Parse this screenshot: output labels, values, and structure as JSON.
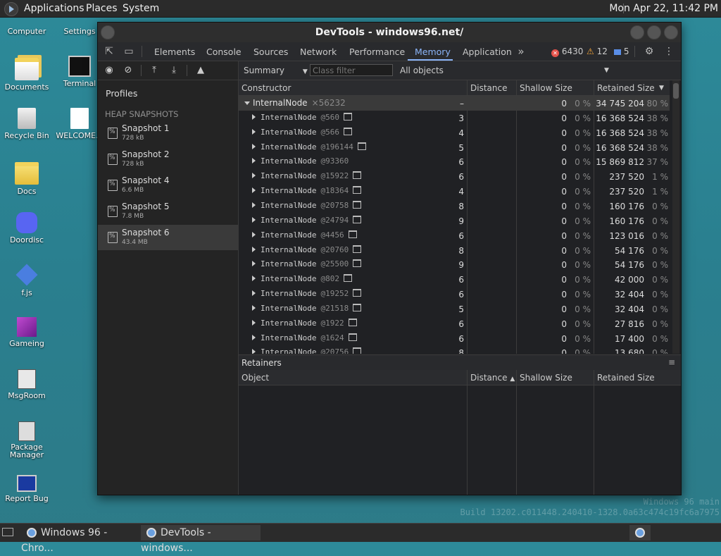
{
  "top_panel": {
    "menu": [
      "Applications",
      "Places",
      "System"
    ],
    "clock": "Mon Apr 22, 11:42 PM"
  },
  "desktop": {
    "icons": [
      "Computer",
      "Settings",
      "Documents",
      "Terminal",
      "Recycle Bin",
      "WELCOME...",
      "Docs",
      "Doordisc",
      "f.js",
      "Gameing",
      "MsgRoom",
      "Package Manager",
      "Report Bug"
    ]
  },
  "window": {
    "title": "DevTools - windows96.net/"
  },
  "devtools": {
    "tabs": [
      "Elements",
      "Console",
      "Sources",
      "Network",
      "Performance",
      "Memory",
      "Application"
    ],
    "active_tab": "Memory",
    "errors": "6430",
    "warnings": "12",
    "messages": "5",
    "left": {
      "profiles_title": "Profiles",
      "heap_header": "HEAP SNAPSHOTS",
      "snapshots": [
        {
          "name": "Snapshot 1",
          "size": "728 kB"
        },
        {
          "name": "Snapshot 2",
          "size": "728 kB"
        },
        {
          "name": "Snapshot 4",
          "size": "6.6 MB"
        },
        {
          "name": "Snapshot 5",
          "size": "7.8 MB"
        },
        {
          "name": "Snapshot 6",
          "size": "43.4 MB"
        }
      ]
    },
    "filter": {
      "view": "Summary",
      "class_filter_placeholder": "Class filter",
      "objects": "All objects"
    },
    "columns": {
      "constructor": "Constructor",
      "distance": "Distance",
      "shallow": "Shallow Size",
      "retained": "Retained Size"
    },
    "parent_row": {
      "name": "InternalNode",
      "id": "×56232",
      "distance": "–",
      "shallow": "0",
      "shallow_pct": "0 %",
      "retained": "34 745 204",
      "retained_pct": "80 %"
    },
    "rows": [
      {
        "name": "InternalNode",
        "id": "@560",
        "icon": true,
        "distance": "3",
        "shallow": "0",
        "shallow_pct": "0 %",
        "retained": "16 368 524",
        "retained_pct": "38 %"
      },
      {
        "name": "InternalNode",
        "id": "@566",
        "icon": true,
        "distance": "4",
        "shallow": "0",
        "shallow_pct": "0 %",
        "retained": "16 368 524",
        "retained_pct": "38 %"
      },
      {
        "name": "InternalNode",
        "id": "@196144",
        "icon": true,
        "distance": "5",
        "shallow": "0",
        "shallow_pct": "0 %",
        "retained": "16 368 524",
        "retained_pct": "38 %"
      },
      {
        "name": "InternalNode",
        "id": "@93360",
        "icon": false,
        "distance": "6",
        "shallow": "0",
        "shallow_pct": "0 %",
        "retained": "15 869 812",
        "retained_pct": "37 %"
      },
      {
        "name": "InternalNode",
        "id": "@15922",
        "icon": true,
        "distance": "6",
        "shallow": "0",
        "shallow_pct": "0 %",
        "retained": "237 520",
        "retained_pct": "1 %"
      },
      {
        "name": "InternalNode",
        "id": "@18364",
        "icon": true,
        "distance": "4",
        "shallow": "0",
        "shallow_pct": "0 %",
        "retained": "237 520",
        "retained_pct": "1 %"
      },
      {
        "name": "InternalNode",
        "id": "@20758",
        "icon": true,
        "distance": "8",
        "shallow": "0",
        "shallow_pct": "0 %",
        "retained": "160 176",
        "retained_pct": "0 %"
      },
      {
        "name": "InternalNode",
        "id": "@24794",
        "icon": true,
        "distance": "9",
        "shallow": "0",
        "shallow_pct": "0 %",
        "retained": "160 176",
        "retained_pct": "0 %"
      },
      {
        "name": "InternalNode",
        "id": "@4456",
        "icon": true,
        "distance": "6",
        "shallow": "0",
        "shallow_pct": "0 %",
        "retained": "123 016",
        "retained_pct": "0 %"
      },
      {
        "name": "InternalNode",
        "id": "@20760",
        "icon": true,
        "distance": "8",
        "shallow": "0",
        "shallow_pct": "0 %",
        "retained": "54 176",
        "retained_pct": "0 %"
      },
      {
        "name": "InternalNode",
        "id": "@25500",
        "icon": true,
        "distance": "9",
        "shallow": "0",
        "shallow_pct": "0 %",
        "retained": "54 176",
        "retained_pct": "0 %"
      },
      {
        "name": "InternalNode",
        "id": "@802",
        "icon": true,
        "distance": "6",
        "shallow": "0",
        "shallow_pct": "0 %",
        "retained": "42 000",
        "retained_pct": "0 %"
      },
      {
        "name": "InternalNode",
        "id": "@19252",
        "icon": true,
        "distance": "6",
        "shallow": "0",
        "shallow_pct": "0 %",
        "retained": "32 404",
        "retained_pct": "0 %"
      },
      {
        "name": "InternalNode",
        "id": "@21518",
        "icon": true,
        "distance": "5",
        "shallow": "0",
        "shallow_pct": "0 %",
        "retained": "32 404",
        "retained_pct": "0 %"
      },
      {
        "name": "InternalNode",
        "id": "@1922",
        "icon": true,
        "distance": "6",
        "shallow": "0",
        "shallow_pct": "0 %",
        "retained": "27 816",
        "retained_pct": "0 %"
      },
      {
        "name": "InternalNode",
        "id": "@1624",
        "icon": true,
        "distance": "6",
        "shallow": "0",
        "shallow_pct": "0 %",
        "retained": "17 400",
        "retained_pct": "0 %"
      },
      {
        "name": "InternalNode",
        "id": "@20756",
        "icon": true,
        "distance": "8",
        "shallow": "0",
        "shallow_pct": "0 %",
        "retained": "13 680",
        "retained_pct": "0 %"
      }
    ],
    "retainers": {
      "title": "Retainers",
      "object": "Object",
      "distance": "Distance",
      "shallow": "Shallow Size",
      "retained": "Retained Size"
    }
  },
  "watermark": {
    "line1": "Windows 96 main",
    "line2": "Build 13202.c011448.240410-1328.0a63c474c19fc6a7975"
  },
  "taskbar": {
    "tasks": [
      "Windows 96 - Chro...",
      "DevTools - windows..."
    ]
  }
}
